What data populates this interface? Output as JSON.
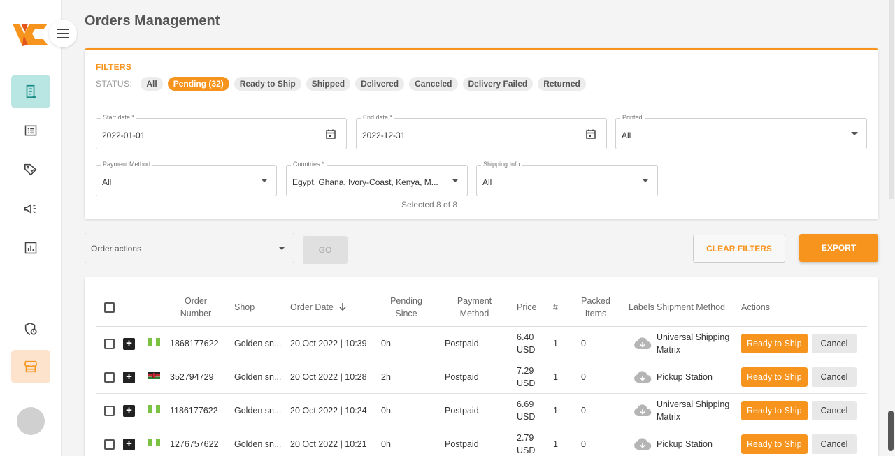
{
  "app": {
    "title": "Orders Management"
  },
  "sidebar": {
    "icons": [
      "orders-icon",
      "list-icon",
      "tag-icon",
      "megaphone-icon",
      "report-icon",
      "shield-clock-icon",
      "store-icon"
    ]
  },
  "filters": {
    "heading": "FILTERS",
    "status_label": "STATUS:",
    "chips": [
      "All",
      "Pending (32)",
      "Ready to Ship",
      "Shipped",
      "Delivered",
      "Canceled",
      "Delivery Failed",
      "Returned"
    ],
    "start_date": {
      "label": "Start date *",
      "value": "2022-01-01"
    },
    "end_date": {
      "label": "End date *",
      "value": "2022-12-31"
    },
    "printed": {
      "label": "Printed",
      "value": "All"
    },
    "payment_method": {
      "label": "Payment Method",
      "value": "All"
    },
    "countries": {
      "label": "Countries *",
      "value": "Egypt, Ghana, Ivory-Coast, Kenya, M...",
      "note": "Selected 8 of 8"
    },
    "shipping_info": {
      "label": "Shipping Info",
      "value": "All"
    }
  },
  "toolbar": {
    "order_actions_placeholder": "Order actions",
    "go_label": "GO",
    "clear_label": "CLEAR FILTERS",
    "export_label": "EXPORT"
  },
  "table": {
    "headers": {
      "order_number": "Order Number",
      "shop": "Shop",
      "order_date": "Order Date",
      "pending_since": "Pending Since",
      "payment_method": "Payment Method",
      "price": "Price",
      "count": "#",
      "packed_items": "Packed Items",
      "labels": "Labels",
      "shipment_method": "Shipment Method",
      "actions": "Actions"
    },
    "rows": [
      {
        "order_number": "1868177622",
        "shop": "Golden sn...",
        "order_date": "20 Oct 2022 | 10:39",
        "pending_since": "0h",
        "payment": "Postpaid",
        "price_amount": "6.40",
        "price_currency": "USD",
        "count": "1",
        "packed": "0",
        "shipment_line1": "Universal Shipping",
        "shipment_line2": "Matrix",
        "rts": "Ready to Ship",
        "cancel": "Cancel",
        "flag": "nigeria"
      },
      {
        "order_number": "352794729",
        "shop": "Golden sn...",
        "order_date": "20 Oct 2022 | 10:28",
        "pending_since": "2h",
        "payment": "Postpaid",
        "price_amount": "7.29",
        "price_currency": "USD",
        "count": "1",
        "packed": "0",
        "shipment_line1": "Pickup Station",
        "shipment_line2": "",
        "rts": "Ready to Ship",
        "cancel": "Cancel",
        "flag": "kenya"
      },
      {
        "order_number": "1186177622",
        "shop": "Golden sn...",
        "order_date": "20 Oct 2022 | 10:24",
        "pending_since": "0h",
        "payment": "Postpaid",
        "price_amount": "6.69",
        "price_currency": "USD",
        "count": "1",
        "packed": "0",
        "shipment_line1": "Universal Shipping",
        "shipment_line2": "Matrix",
        "rts": "Ready to Ship",
        "cancel": "Cancel",
        "flag": "nigeria"
      },
      {
        "order_number": "1276757622",
        "shop": "Golden sn...",
        "order_date": "20 Oct 2022 | 10:21",
        "pending_since": "0h",
        "payment": "Postpaid",
        "price_amount": "2.79",
        "price_currency": "USD",
        "count": "1",
        "packed": "0",
        "shipment_line1": "Pickup Station",
        "shipment_line2": "",
        "rts": "Ready to Ship",
        "cancel": "Cancel",
        "flag": "nigeria"
      }
    ]
  },
  "colors": {
    "accent": "#f7941d",
    "active_nav": "#b9e6e3",
    "store_nav": "#fde2cc"
  }
}
